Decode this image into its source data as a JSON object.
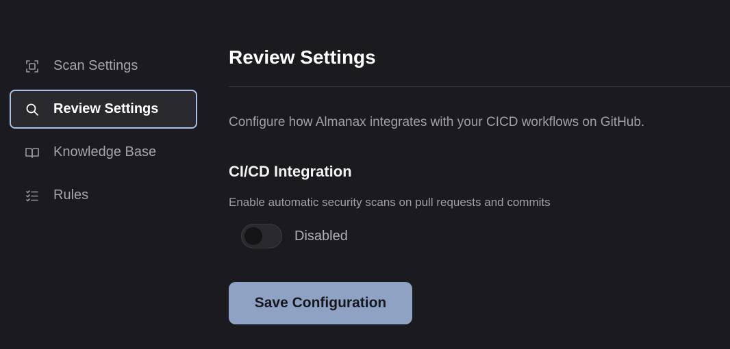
{
  "sidebar": {
    "items": [
      {
        "label": "Scan Settings",
        "icon": "scan-icon",
        "active": false
      },
      {
        "label": "Review Settings",
        "icon": "search-icon",
        "active": true
      },
      {
        "label": "Knowledge Base",
        "icon": "book-icon",
        "active": false
      },
      {
        "label": "Rules",
        "icon": "checklist-icon",
        "active": false
      }
    ]
  },
  "main": {
    "title": "Review Settings",
    "description": "Configure how Almanax integrates with your CICD workflows on GitHub.",
    "section": {
      "title": "CI/CD Integration",
      "description": "Enable automatic security scans on pull requests and commits",
      "toggle": {
        "enabled": false,
        "label": "Disabled"
      }
    },
    "save_label": "Save Configuration"
  },
  "colors": {
    "background": "#1b1b1f",
    "active_border": "#a9c1e6",
    "button": "#8ea3c4"
  }
}
